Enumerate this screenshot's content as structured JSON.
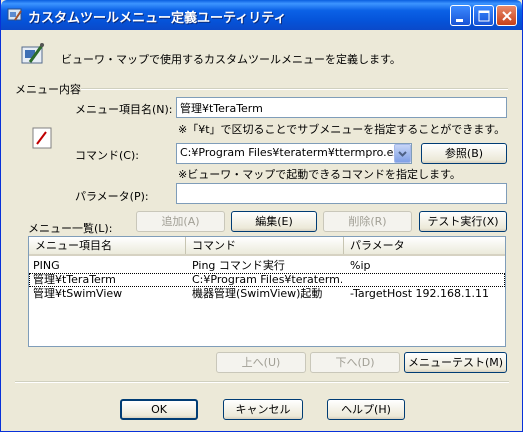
{
  "window": {
    "title": "カスタムツールメニュー定義ユーティリティ"
  },
  "header": {
    "description": "ビューワ・マップで使用するカスタムツールメニューを定義します。"
  },
  "menu_group": {
    "label": "メニュー内容",
    "item_name_label": "メニュー項目名(N):",
    "item_name_value": "管理¥tTeraTerm",
    "item_name_hint": "※「¥t」で区切ることでサブメニューを指定することができます。",
    "command_label": "コマンド(C):",
    "command_value": "C:¥Program Files¥teraterm¥ttermpro.exe",
    "browse_button": "参照(B)",
    "command_hint": "※ビューワ・マップで起動できるコマンドを指定します。",
    "param_label": "パラメータ(P):",
    "param_value": ""
  },
  "list_section": {
    "label": "メニュー一覧(L):",
    "add_button": "追加(A)",
    "edit_button": "編集(E)",
    "delete_button": "削除(R)",
    "test_run_button": "テスト実行(X)",
    "columns": [
      "メニュー項目名",
      "コマンド",
      "パラメータ"
    ],
    "rows": [
      [
        "PING",
        "Ping コマンド実行",
        "%ip"
      ],
      [
        "管理¥tTeraTerm",
        "C:¥Program Files¥teraterm...",
        ""
      ],
      [
        "管理¥tSwimView",
        "機器管理(SwimView)起動",
        "-TargetHost 192.168.1.11"
      ]
    ],
    "up_button": "上へ(U)",
    "down_button": "下へ(D)",
    "menu_test_button": "メニューテスト(M)"
  },
  "footer": {
    "ok_button": "OK",
    "cancel_button": "キャンセル",
    "help_button": "ヘルプ(H)"
  }
}
